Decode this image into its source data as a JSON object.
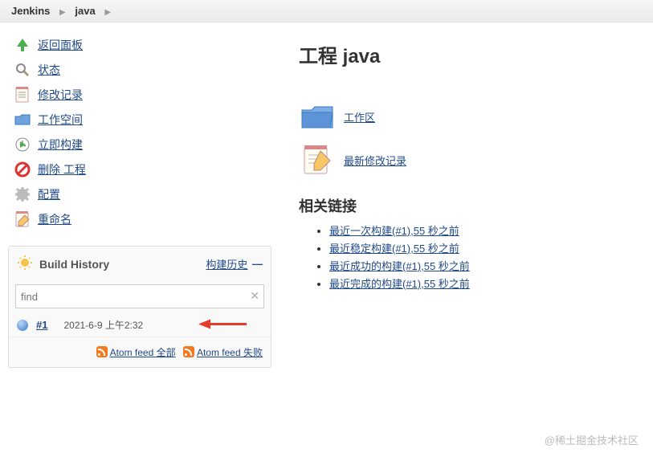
{
  "breadcrumb": {
    "root": "Jenkins",
    "project": "java"
  },
  "menu": [
    {
      "label": "返回面板"
    },
    {
      "label": "状态"
    },
    {
      "label": "修改记录"
    },
    {
      "label": "工作空间"
    },
    {
      "label": "立即构建"
    },
    {
      "label": "删除 工程"
    },
    {
      "label": "配置"
    },
    {
      "label": "重命名"
    }
  ],
  "buildHistory": {
    "title": "Build History",
    "trendLink": "构建历史",
    "findPlaceholder": "find",
    "builds": [
      {
        "id": "#1",
        "time": "2021-6-9 上午2:32"
      }
    ],
    "feedAll": "Atom feed 全部",
    "feedFail": "Atom feed 失败"
  },
  "main": {
    "title": "工程 java",
    "workspaceLink": "工作区",
    "changesLink": "最新修改记录",
    "relatedHeader": "相关链接",
    "related": [
      "最近一次构建(#1),55 秒之前",
      "最近稳定构建(#1),55 秒之前",
      "最近成功的构建(#1),55 秒之前",
      "最近完成的构建(#1),55 秒之前"
    ]
  },
  "watermark": "@稀土掘金技术社区"
}
